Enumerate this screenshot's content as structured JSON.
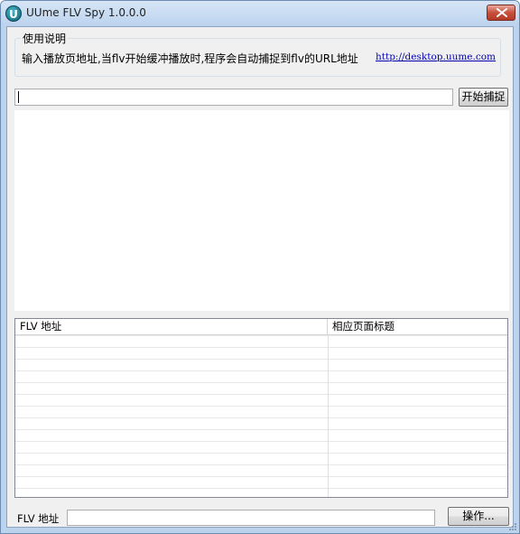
{
  "window": {
    "title": "UUme FLV Spy 1.0.0.0",
    "icon_letter": "U"
  },
  "usage": {
    "group_title": "使用说明",
    "description": "输入播放页地址,当flv开始缓冲播放时,程序会自动捕捉到flv的URL地址",
    "link": "http://desktop.uume.com"
  },
  "url_input": {
    "value": ""
  },
  "start_button": {
    "label": "开始捕捉"
  },
  "listview": {
    "columns": [
      "FLV 地址",
      "相应页面标题"
    ],
    "rows": []
  },
  "bottom": {
    "label": "FLV 地址",
    "value": "",
    "operate_button": "操作..."
  },
  "colors": {
    "titlebar": "#bcd3ee",
    "client": "#f0f0f0",
    "link": "#0000aa",
    "close": "#c7503c"
  }
}
